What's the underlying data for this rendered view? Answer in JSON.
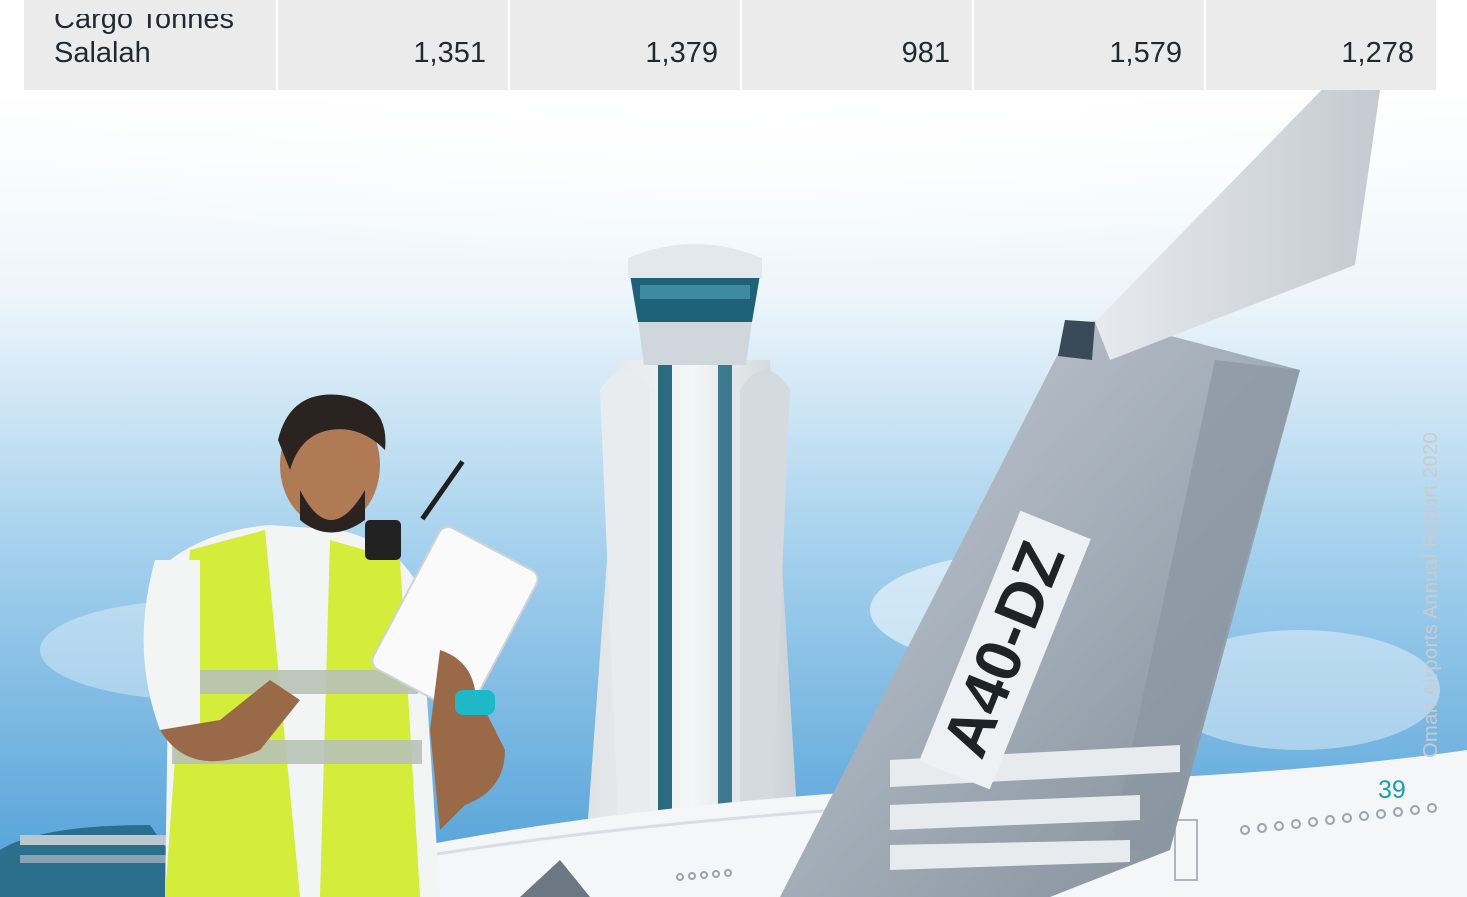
{
  "table": {
    "row_label_line1": "Cargo Tonnes",
    "row_label_line2": "Salalah",
    "values": [
      "1,351",
      "1,379",
      "981",
      "1,579",
      "1,278"
    ]
  },
  "aircraft_registration": "A40-DZ",
  "footer": {
    "report_title": "Oman Airports Annual Report 2020",
    "page_number": "39"
  },
  "colors": {
    "accent": "#1aa1a8",
    "table_bg": "#ebebeb",
    "vest": "#d4ec3a",
    "sky_blue": "#6fb3df"
  }
}
